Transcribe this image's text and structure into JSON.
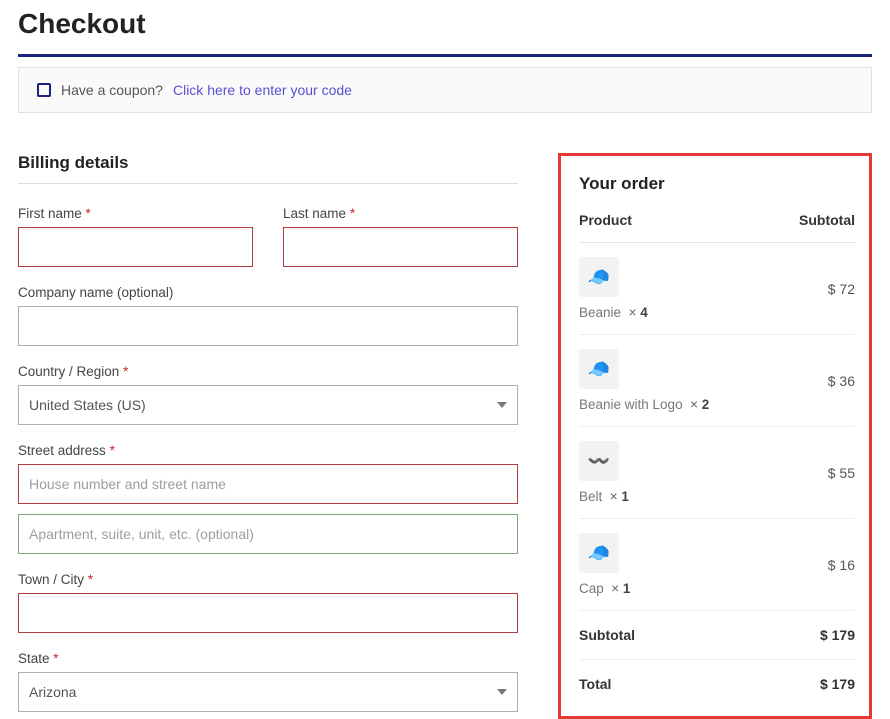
{
  "page": {
    "title": "Checkout"
  },
  "coupon": {
    "prompt": "Have a coupon?",
    "link": "Click here to enter your code"
  },
  "billing": {
    "title": "Billing details",
    "first_name_label": "First name",
    "last_name_label": "Last name",
    "company_label": "Company name (optional)",
    "country_label": "Country / Region",
    "country_value": "United States (US)",
    "street_label": "Street address",
    "street_ph1": "House number and street name",
    "street_ph2": "Apartment, suite, unit, etc. (optional)",
    "city_label": "Town / City",
    "state_label": "State",
    "state_value": "Arizona",
    "asterisk": "*"
  },
  "order": {
    "title": "Your order",
    "head_product": "Product",
    "head_subtotal": "Subtotal",
    "items": [
      {
        "name": "Beanie",
        "qty": "4",
        "price": "$ 72",
        "emoji": "🧢",
        "color": "#e8a79c"
      },
      {
        "name": "Beanie with Logo",
        "qty": "2",
        "price": "$ 36",
        "emoji": "🧢",
        "color": "#a7c7e8"
      },
      {
        "name": "Belt",
        "qty": "1",
        "price": "$ 55",
        "emoji": "〰️",
        "color": "#c7b29c"
      },
      {
        "name": "Cap",
        "qty": "1",
        "price": "$ 16",
        "emoji": "🧢",
        "color": "#e8d97c"
      }
    ],
    "times": "×",
    "subtotal_label": "Subtotal",
    "subtotal_value": "$ 179",
    "total_label": "Total",
    "total_value": "$ 179"
  }
}
